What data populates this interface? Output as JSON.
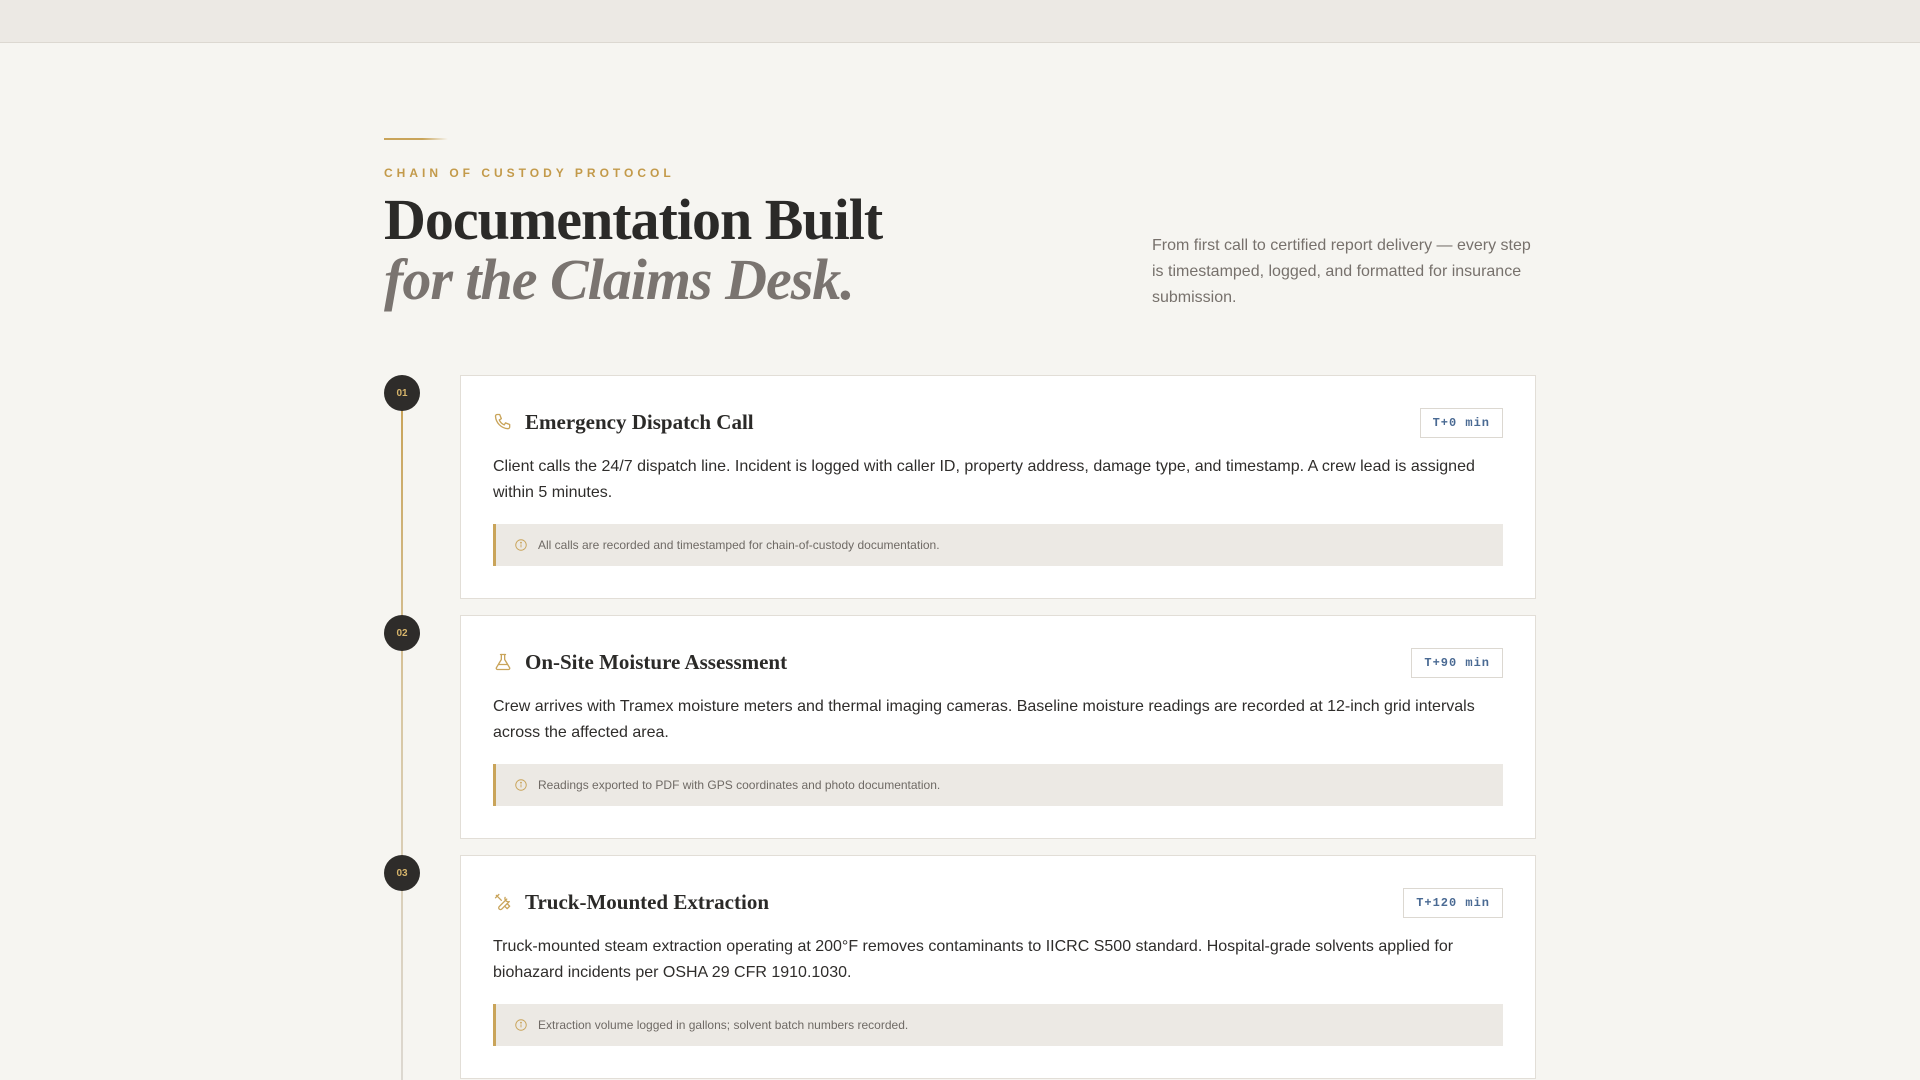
{
  "header": {
    "eyebrow": "CHAIN OF CUSTODY PROTOCOL",
    "title_line1": "Documentation Built",
    "title_line2": "for the Claims Desk.",
    "intro": "From first call to certified report delivery — every step is timestamped, logged, and formatted for insurance submission."
  },
  "colors": {
    "accent": "#c9a45a",
    "dark": "#2e2c2a",
    "tag_text": "#4a6a93",
    "background": "#f6f5f1"
  },
  "steps": [
    {
      "number": "01",
      "icon": "phone-icon",
      "title": "Emergency Dispatch Call",
      "tag": "T+0 min",
      "body": "Client calls the 24/7 dispatch line. Incident is logged with caller ID, property address, damage type, and timestamp. A crew lead is assigned within 5 minutes.",
      "note": "All calls are recorded and timestamped for chain-of-custody documentation."
    },
    {
      "number": "02",
      "icon": "flask-icon",
      "title": "On-Site Moisture Assessment",
      "tag": "T+90 min",
      "body": "Crew arrives with Tramex moisture meters and thermal imaging cameras. Baseline moisture readings are recorded at 12-inch grid intervals across the affected area.",
      "note": "Readings exported to PDF with GPS coordinates and photo documentation."
    },
    {
      "number": "03",
      "icon": "tools-icon",
      "title": "Truck-Mounted Extraction",
      "tag": "T+120 min",
      "body": "Truck-mounted steam extraction operating at 200°F removes contaminants to IICRC S500 standard. Hospital-grade solvents applied for biohazard incidents per OSHA 29 CFR 1910.1030.",
      "note": "Extraction volume logged in gallons; solvent batch numbers recorded."
    }
  ]
}
